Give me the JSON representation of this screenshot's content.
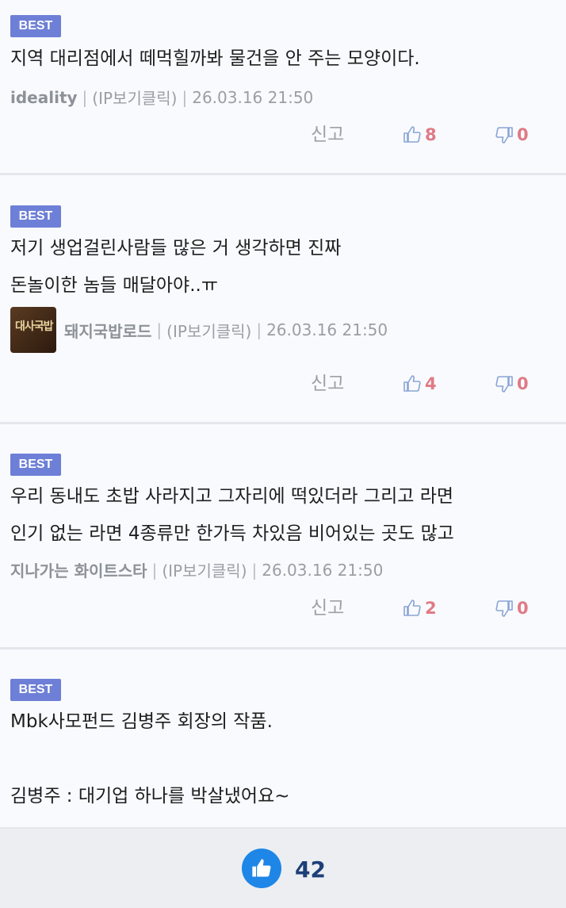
{
  "comments": [
    {
      "badge": "BEST",
      "text": "지역 대리점에서 떼먹힐까봐 물건을 안 주는 모양이다.",
      "nick": "ideality",
      "ip": "(IP보기클릭)",
      "time": "26.03.16 21:50",
      "report": "신고",
      "up": "8",
      "down": "0"
    },
    {
      "badge": "BEST",
      "text": "저기 생업걸린사람들 많은 거 생각하면 진짜\n돈놀이한 놈들 매달아야..ㅠ",
      "nick": "돼지국밥로드",
      "ip": "(IP보기클릭)",
      "time": "26.03.16 21:50",
      "report": "신고",
      "up": "4",
      "down": "0"
    },
    {
      "badge": "BEST",
      "text": "우리 동내도 초밥 사라지고 그자리에 떡있더라 그리고 라면\n인기 없는 라면 4종류만 한가득 차있음 비어있는 곳도 많고",
      "nick": "지나가는 화이트스타",
      "ip": "(IP보기클릭)",
      "time": "26.03.16 21:50",
      "report": "신고",
      "up": "2",
      "down": "0"
    },
    {
      "badge": "BEST",
      "text": "Mbk사모펀드 김병주 회장의 작품.\n\n김병주 : 대기업 하나를 박살냈어요~"
    }
  ],
  "footer": {
    "like_count": "42"
  },
  "icons": {
    "thumb_up": "thumb-up-icon",
    "thumb_down": "thumb-down-icon",
    "like": "like-icon"
  },
  "colors": {
    "badge": "#6d7fd6",
    "vote": "#e07a86",
    "like_button": "#1e86e6"
  }
}
